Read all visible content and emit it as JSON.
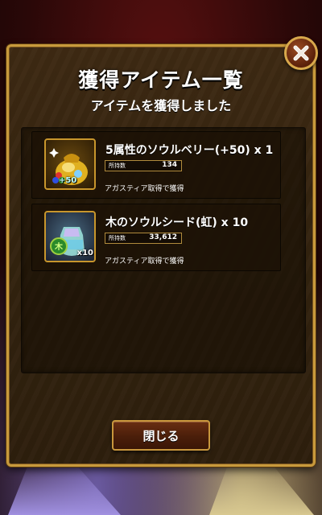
{
  "dialog": {
    "title": "獲得アイテム一覧",
    "subtitle": "アイテムを獲得しました",
    "close_button_label": "閉じる"
  },
  "items": [
    {
      "name": "5属性のソウルベリー(+50) x 1",
      "owned_label": "所持数",
      "owned_value": "134",
      "source": "アガスティア取得で獲得",
      "badge": "+50",
      "icon": "soul-berry-gold-pouch-icon"
    },
    {
      "name": "木のソウルシード(虹) x 10",
      "owned_label": "所持数",
      "owned_value": "33,612",
      "source": "アガスティア取得で獲得",
      "badge": "x10",
      "icon": "wood-soul-seed-rainbow-icon"
    }
  ],
  "colors": {
    "frame_gold": "#c89a3c",
    "panel_brown": "#33230f",
    "button_red": "#4a1e0a"
  }
}
